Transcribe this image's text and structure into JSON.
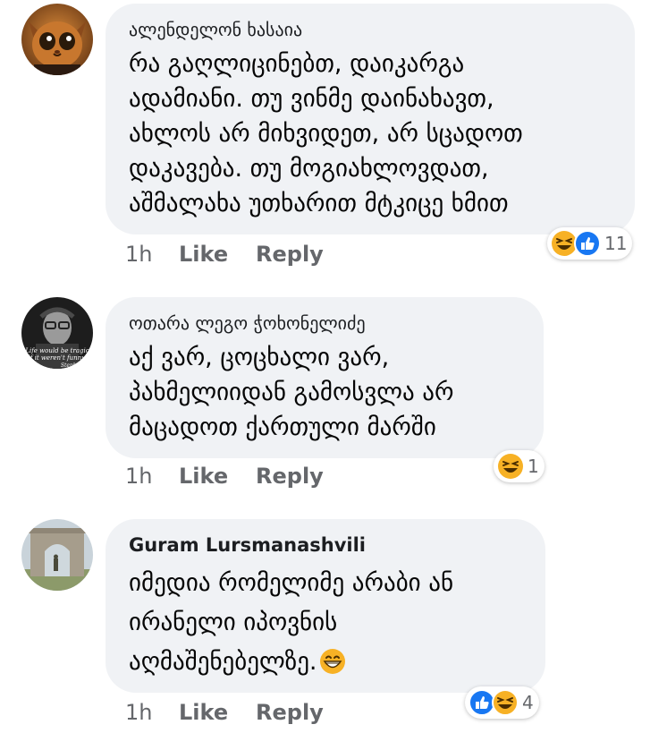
{
  "comments": [
    {
      "author": "ალენდელონ ხასაია",
      "lines": [
        "რა გაღლიცინებთ, დაიკარგა",
        "ადამიანი. თუ ვინმე დაინახავთ,",
        "ახლოს არ მიხვიდეთ, არ სცადოთ",
        "დაკავება. თუ მოგიახლოვდათ,",
        "აშმალახა უთხარით მტკიცე ხმით"
      ],
      "time": "1h",
      "like_label": "Like",
      "reply_label": "Reply",
      "reactions": [
        "haha-icon",
        "like-icon"
      ],
      "reaction_count": "11"
    },
    {
      "author": "ოთარა ლეგო ჭოხონელიძე",
      "lines": [
        "აქ ვარ, ცოცხალი ვარ,",
        "პახმელიიდან გამოსვლა არ",
        "მაცადოთ ქართული მარში"
      ],
      "avatar_caption": "Life would be tragic if it weren't funny. Stephen H",
      "time": "1h",
      "like_label": "Like",
      "reply_label": "Reply",
      "reactions": [
        "haha-icon"
      ],
      "reaction_count": "1"
    },
    {
      "author": "Guram Lursmanashvili",
      "lines": [
        "იმედია რომელიმე არაბი ან",
        "ირანელი იპოვნის",
        "აღმაშენებელზე."
      ],
      "trailing_emoji": "grinning-face-icon",
      "time": "1h",
      "like_label": "Like",
      "reply_label": "Reply",
      "reactions": [
        "like-icon",
        "haha-icon"
      ],
      "reaction_count": "4"
    }
  ],
  "colors": {
    "bubble": "#f0f2f5",
    "meta": "#65676b",
    "like_blue": "#1877f2",
    "haha_yellow": "#f7b125"
  }
}
